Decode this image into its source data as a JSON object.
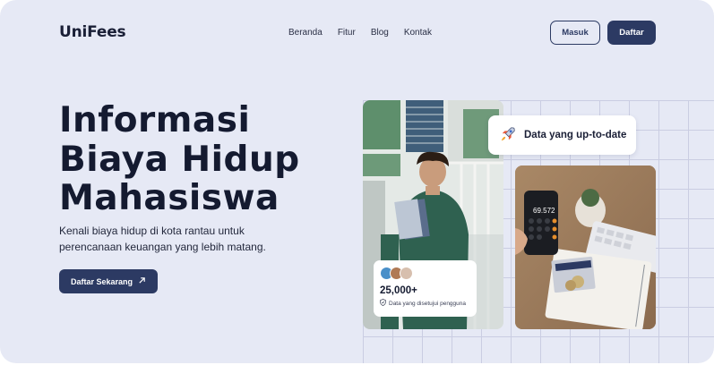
{
  "header": {
    "logo": "UniFees",
    "nav": [
      "Beranda",
      "Fitur",
      "Blog",
      "Kontak"
    ],
    "login_label": "Masuk",
    "signup_label": "Daftar"
  },
  "hero": {
    "title_lines": [
      "Informasi",
      "Biaya Hidup",
      "Mahasiswa"
    ],
    "subtitle_line1": "Kenali biaya hidup di kota rantau untuk",
    "subtitle_line2": "perencanaan keuangan yang lebih matang.",
    "cta_label": "Daftar Sekarang",
    "cta_icon": "arrow-up-right-icon"
  },
  "badge": {
    "icon": "rocket-icon",
    "label": "Data yang up-to-date"
  },
  "stat": {
    "value": "25,000+",
    "caption": "Data yang disetujui pengguna",
    "caption_icon": "shield-check-icon"
  },
  "calculator": {
    "display": "69.572"
  },
  "colors": {
    "background": "#e6e9f5",
    "primary": "#2c3a63",
    "text_dark": "#141a30"
  }
}
